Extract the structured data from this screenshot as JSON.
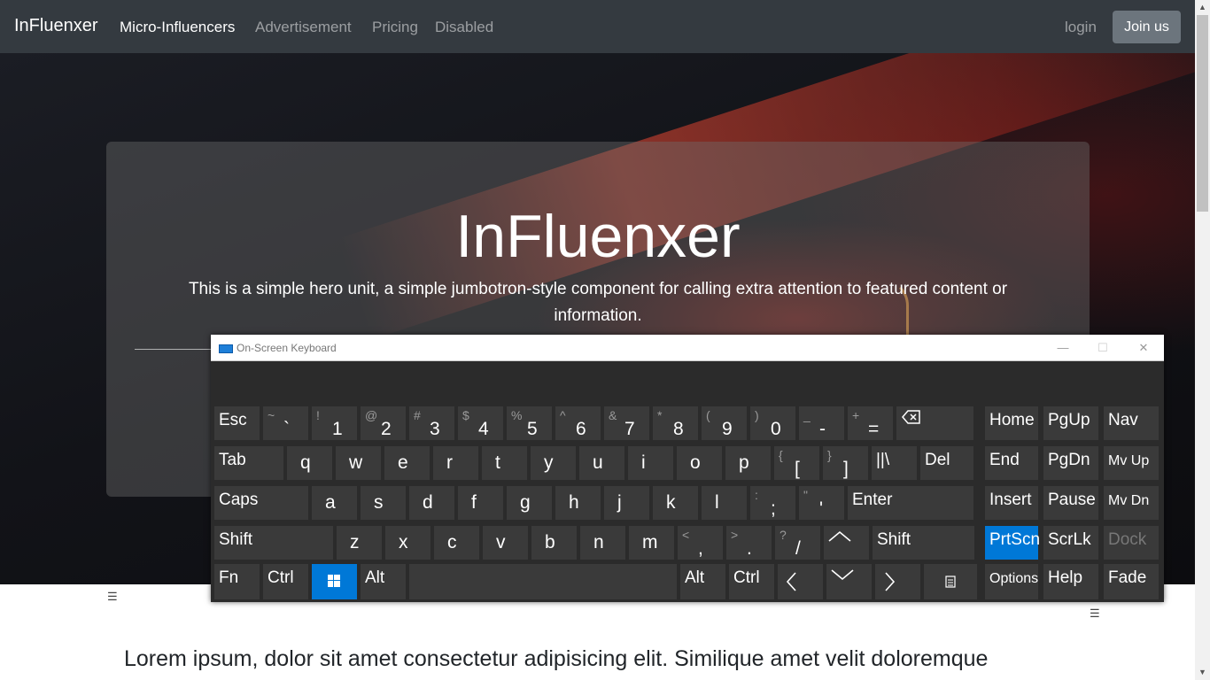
{
  "navbar": {
    "brand": "InFluenxer",
    "links": [
      "Micro-Influencers",
      "Advertisement",
      "Pricing",
      "Disabled"
    ],
    "login": "login",
    "join": "Join us"
  },
  "hero": {
    "title": "InFluenxer",
    "lead": "This is a simple hero unit, a simple jumbotron-style component for calling extra attention to featured content or information."
  },
  "content": {
    "lorem": "Lorem ipsum, dolor sit amet consectetur adipisicing elit. Similique amet velit doloremque"
  },
  "osk": {
    "title": "On-Screen Keyboard",
    "window_buttons": [
      "—",
      "☐",
      "✕"
    ],
    "rows": [
      [
        "Esc",
        "~|`",
        "!|1",
        "@|2",
        "#|3",
        "$|4",
        "%|5",
        "^|6",
        "&|7",
        "*|8",
        "(|9",
        ")|0",
        "_|-",
        "+|=",
        "⌫"
      ],
      [
        "Tab",
        "q",
        "w",
        "e",
        "r",
        "t",
        "y",
        "u",
        "i",
        "o",
        "p",
        "{|[",
        "}|]",
        "||\\",
        "Del"
      ],
      [
        "Caps",
        "a",
        "s",
        "d",
        "f",
        "g",
        "h",
        "j",
        "k",
        "l",
        ":|;",
        "\"|'",
        "Enter"
      ],
      [
        "Shift",
        "z",
        "x",
        "c",
        "v",
        "b",
        "n",
        "m",
        "<|,",
        ">|.",
        "?|/",
        "^",
        "Shift"
      ],
      [
        "Fn",
        "Ctrl",
        "Win",
        "Alt",
        "",
        "Alt",
        "Ctrl",
        "<",
        "v",
        ">",
        "Menu"
      ]
    ],
    "nav_keys": [
      [
        "Home",
        "PgUp",
        "Nav"
      ],
      [
        "End",
        "PgDn",
        "Mv Up"
      ],
      [
        "Insert",
        "Pause",
        "Mv Dn"
      ],
      [
        "PrtScn",
        "ScrLk",
        "Dock"
      ],
      [
        "Options",
        "Help",
        "Fade"
      ]
    ],
    "active_key": "PrtScn",
    "disabled_key": "Dock",
    "accent_color": "#0078d7"
  }
}
